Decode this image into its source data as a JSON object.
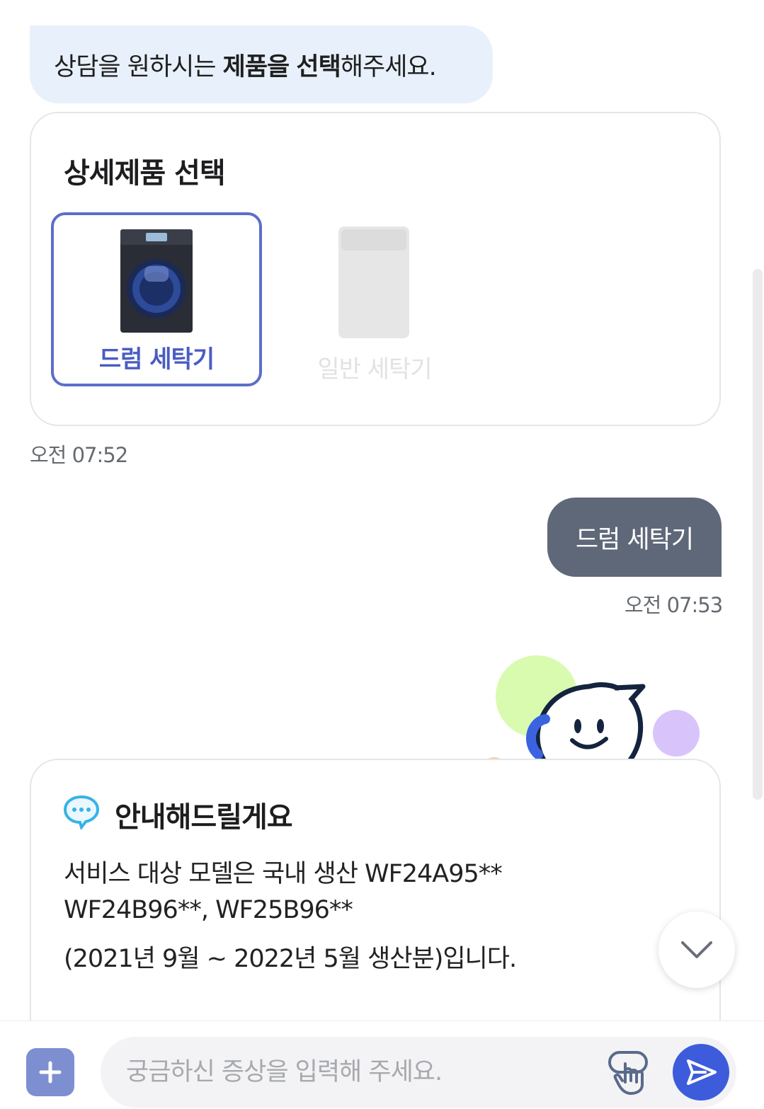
{
  "chat": {
    "bot_prompt_pre": "상담을 원하시는 ",
    "bot_prompt_bold1": "제품을",
    "bot_prompt_space": " ",
    "bot_prompt_bold2": "선택",
    "bot_prompt_post": "해주세요.",
    "product_card": {
      "title": "상세제품 선택",
      "products": [
        {
          "label": "드럼 세탁기",
          "selected": true,
          "icon": "drum-washer-image"
        },
        {
          "label": "일반 세탁기",
          "selected": false,
          "icon": "top-load-washer-image"
        }
      ]
    },
    "bot_time_1": "오전 07:52",
    "user_message": "드럼 세탁기",
    "user_time": "오전 07:53",
    "info_card": {
      "title": "안내해드릴게요",
      "icon": "chat-bubble-icon",
      "lines": [
        "서비스 대상 모델은 국내 생산 WF24A95**",
        "WF24B96**, WF25B96**",
        "(2021년 9월 ~ 2022년 5월 생산분)입니다."
      ]
    }
  },
  "input_bar": {
    "placeholder": "궁금하신 증상을 입력해 주세요.",
    "value": ""
  },
  "colors": {
    "accent": "#5b6ec9",
    "user_bubble": "#5f6879",
    "bot_bubble": "#e8f1fb",
    "send_button": "#3d5cdc"
  }
}
